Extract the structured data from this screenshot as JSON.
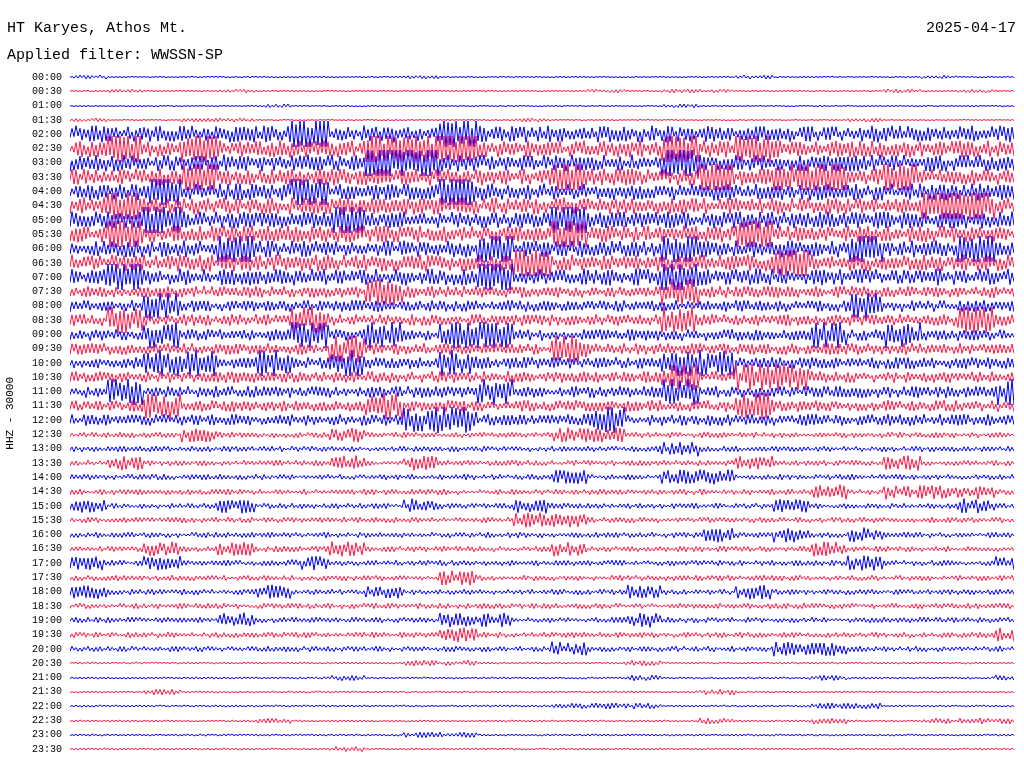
{
  "station": {
    "title": "HT Karyes, Athos Mt.",
    "date": "2025-04-17",
    "filter": "Applied filter: WWSSN-SP",
    "channel_label": "HHZ - 30000"
  },
  "traces": [
    {
      "time": "00:00",
      "color": "#0000ff"
    },
    {
      "time": "00:30",
      "color": "#ff1744"
    },
    {
      "time": "01:00",
      "color": "#0000ff"
    },
    {
      "time": "01:30",
      "color": "#ff1744"
    },
    {
      "time": "02:00",
      "color": "#0000ff"
    },
    {
      "time": "02:30",
      "color": "#ff1744"
    },
    {
      "time": "03:00",
      "color": "#0000ff"
    },
    {
      "time": "03:30",
      "color": "#ff1744"
    },
    {
      "time": "04:00",
      "color": "#0000ff"
    },
    {
      "time": "04:30",
      "color": "#ff1744"
    },
    {
      "time": "05:00",
      "color": "#0000ff"
    },
    {
      "time": "05:30",
      "color": "#ff1744"
    },
    {
      "time": "06:00",
      "color": "#0000ff"
    },
    {
      "time": "06:30",
      "color": "#ff1744"
    },
    {
      "time": "07:00",
      "color": "#0000ff"
    },
    {
      "time": "07:30",
      "color": "#ff1744"
    },
    {
      "time": "08:00",
      "color": "#0000ff"
    },
    {
      "time": "08:30",
      "color": "#ff1744"
    },
    {
      "time": "09:00",
      "color": "#0000ff"
    },
    {
      "time": "09:30",
      "color": "#ff1744"
    },
    {
      "time": "10:00",
      "color": "#0000ff"
    },
    {
      "time": "10:30",
      "color": "#ff1744"
    },
    {
      "time": "11:00",
      "color": "#0000ff"
    },
    {
      "time": "11:30",
      "color": "#ff1744"
    },
    {
      "time": "12:00",
      "color": "#0000ff"
    },
    {
      "time": "12:30",
      "color": "#ff1744"
    },
    {
      "time": "13:00",
      "color": "#0000ff"
    },
    {
      "time": "13:30",
      "color": "#ff1744"
    },
    {
      "time": "14:00",
      "color": "#0000ff"
    },
    {
      "time": "14:30",
      "color": "#ff1744"
    },
    {
      "time": "15:00",
      "color": "#0000ff"
    },
    {
      "time": "15:30",
      "color": "#ff1744"
    },
    {
      "time": "16:00",
      "color": "#0000ff"
    },
    {
      "time": "16:30",
      "color": "#ff1744"
    },
    {
      "time": "17:00",
      "color": "#0000ff"
    },
    {
      "time": "17:30",
      "color": "#ff1744"
    },
    {
      "time": "18:00",
      "color": "#0000ff"
    },
    {
      "time": "18:30",
      "color": "#ff1744"
    },
    {
      "time": "19:00",
      "color": "#0000ff"
    },
    {
      "time": "19:30",
      "color": "#ff1744"
    },
    {
      "time": "20:00",
      "color": "#0000ff"
    },
    {
      "time": "20:30",
      "color": "#ff1744"
    },
    {
      "time": "21:00",
      "color": "#0000ff"
    },
    {
      "time": "21:30",
      "color": "#ff1744"
    },
    {
      "time": "22:00",
      "color": "#0000ff"
    },
    {
      "time": "22:30",
      "color": "#ff1744"
    },
    {
      "time": "23:00",
      "color": "#0000ff"
    },
    {
      "time": "23:30",
      "color": "#ff1744"
    }
  ]
}
